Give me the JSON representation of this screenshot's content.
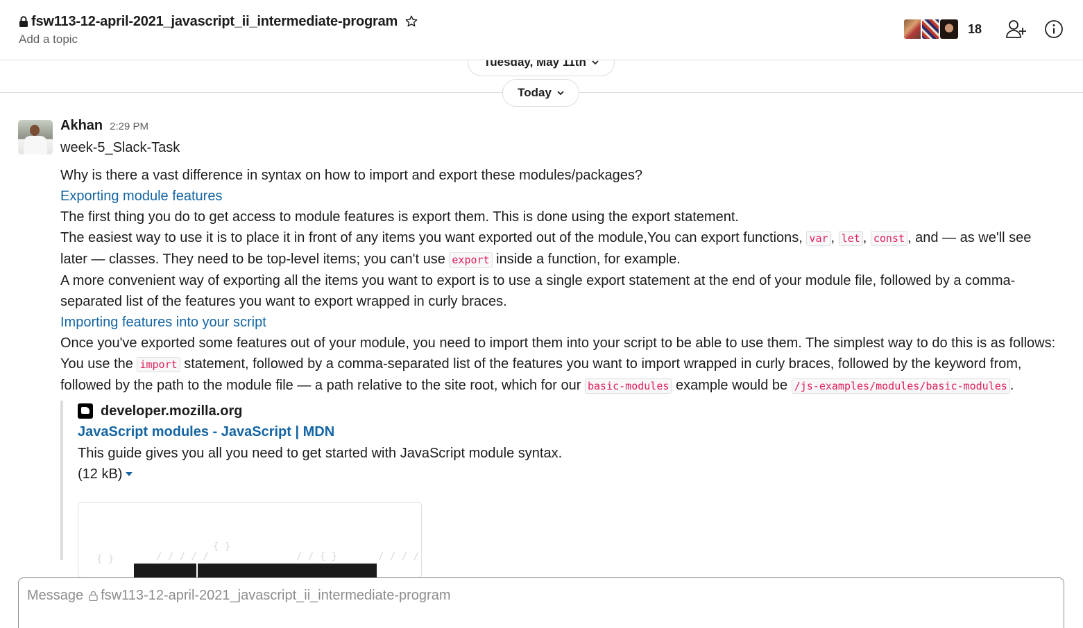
{
  "header": {
    "channel_name": "fsw113-12-april-2021_javascript_ii_intermediate-program",
    "topic_placeholder": "Add a topic",
    "member_count": "18"
  },
  "dividers": {
    "previous_date": "Tuesday, May 11th",
    "current_date": "Today"
  },
  "message": {
    "author": "Akhan",
    "time": "2:29 PM",
    "attachment_title": "week-5_Slack-Task",
    "question": "Why is there a vast difference in syntax on how to import and export these modules/packages?",
    "link1": "Exporting module features",
    "p1": "The first thing you do to get access to module features is export them. This is done using the export statement.",
    "p2a": "The easiest way to use it is to place it in front of any items you want exported out of the module,You can export functions, ",
    "code_var": "var",
    "sep_comma": ", ",
    "code_let": "let",
    "code_const": "const",
    "p2b": ", and — as we'll see later — classes. They need to be top-level items; you can't use ",
    "code_export": "export",
    "p2c": " inside a function, for example.",
    "p3": "A more convenient way of exporting all the items you want to export is to use a single export statement at the end of your module file, followed by a comma-separated list of the features you want to export wrapped in curly braces.",
    "link2": "Importing features into your script",
    "p4a": "Once you've exported some features out of your module, you need to import them into your script to be able to use them. The simplest way to do this is as follows:  You use the ",
    "code_import": "import",
    "p4b": " statement, followed by a comma-separated list of the features you want to import wrapped in curly braces, followed by the keyword from, followed by the path to the module file — a path relative to the site root, which for our ",
    "code_basic": "basic-modules",
    "p4c": " example would be ",
    "code_path": "/js-examples/modules/basic-modules",
    "p4d": "."
  },
  "unfurl": {
    "site": "developer.mozilla.org",
    "title": "JavaScript modules - JavaScript | MDN",
    "description": "This guide gives you all you need to get started with JavaScript module syntax.",
    "size": "(12 kB)"
  },
  "composer": {
    "placeholder_prefix": "Message",
    "placeholder_channel": "fsw113-12-april-2021_javascript_ii_intermediate-program"
  },
  "colors": {
    "link": "#1264a3",
    "code": "#e01e5a",
    "muted": "#616061"
  }
}
